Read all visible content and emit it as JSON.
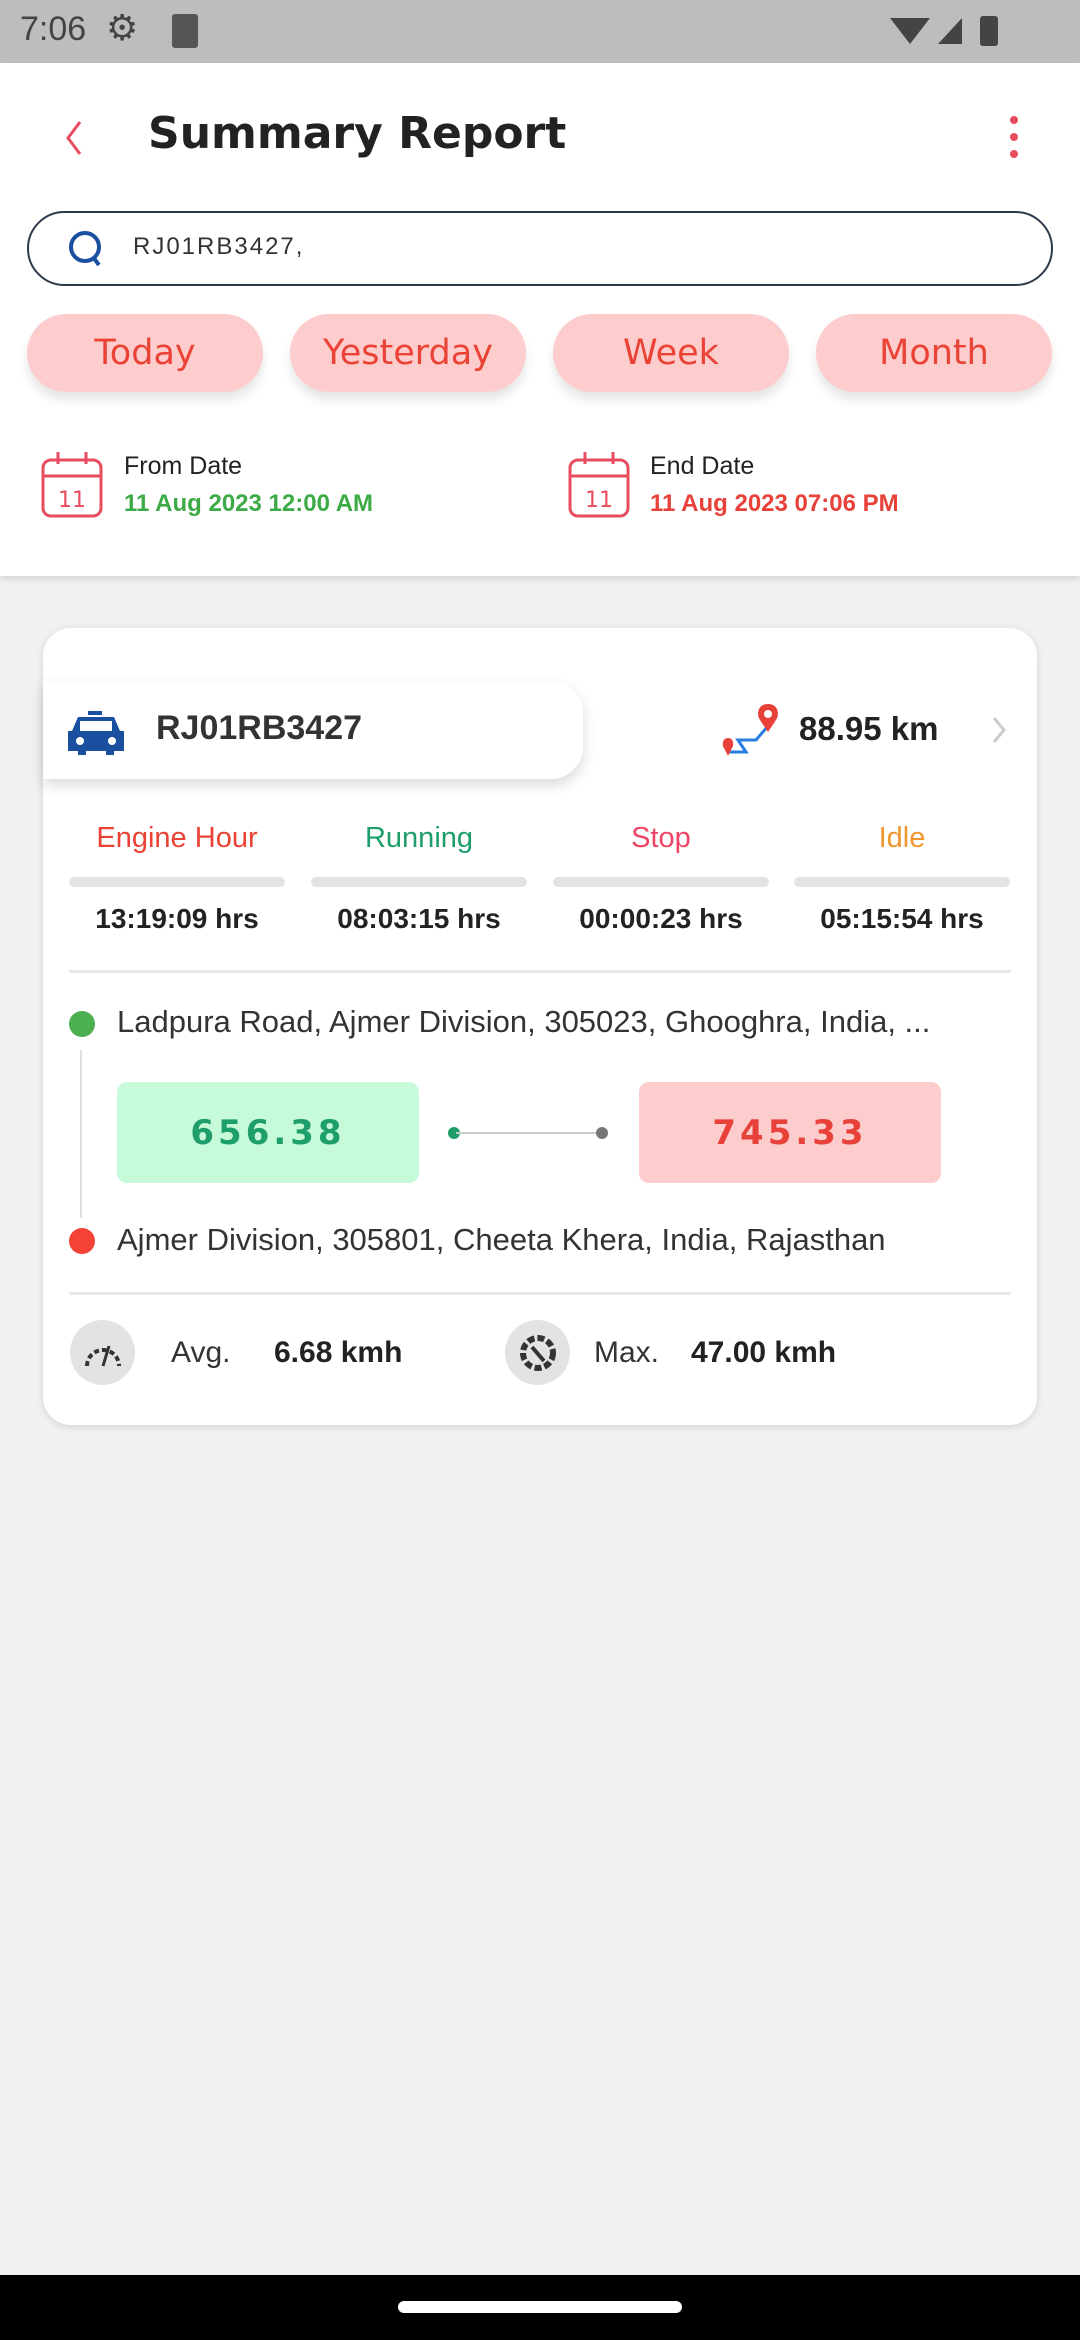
{
  "status_bar": {
    "time": "7:06"
  },
  "header": {
    "title": "Summary Report"
  },
  "search": {
    "value": "RJ01RB3427,"
  },
  "filters": [
    "Today",
    "Yesterday",
    "Week",
    "Month"
  ],
  "dates": {
    "from_label": "From Date",
    "from_value": "11 Aug 2023 12:00 AM",
    "end_label": "End Date",
    "end_value": "11 Aug 2023 07:06 PM",
    "calendar_day": "11"
  },
  "card": {
    "vehicle": "RJ01RB3427",
    "distance": "88.95 km",
    "stats": [
      {
        "label": "Engine Hour",
        "value": "13:19:09 hrs",
        "color": "#ea4335"
      },
      {
        "label": "Running",
        "value": "08:03:15 hrs",
        "color": "#1e9e6a"
      },
      {
        "label": "Stop",
        "value": "00:00:23 hrs",
        "color": "#ee4466"
      },
      {
        "label": "Idle",
        "value": "05:15:54 hrs",
        "color": "#f0962e"
      }
    ],
    "start_address": "Ladpura Road, Ajmer Division, 305023, Ghooghra, India, ...",
    "start_odometer": "656.38",
    "end_odometer": "745.33",
    "end_address": "Ajmer Division, 305801, Cheeta Khera, India, Rajasthan",
    "avg_label": "Avg.",
    "avg_value": "6.68 kmh",
    "max_label": "Max.",
    "max_value": "47.00 kmh"
  }
}
